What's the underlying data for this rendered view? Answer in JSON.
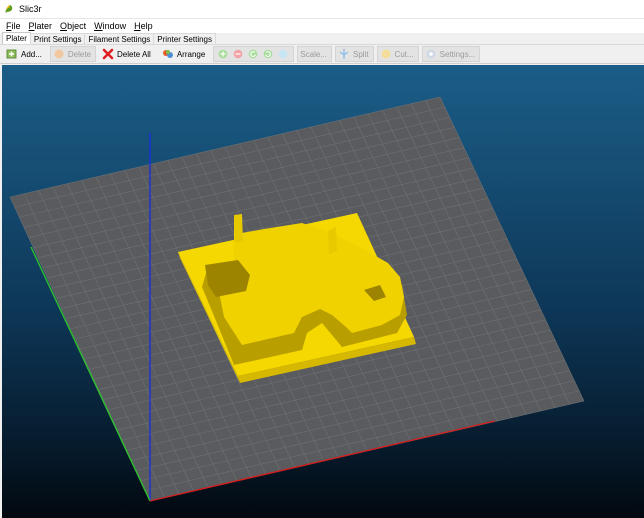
{
  "window": {
    "title": "Slic3r"
  },
  "menu": {
    "items": [
      {
        "label": "File",
        "accel": "F",
        "rest": "ile"
      },
      {
        "label": "Plater",
        "accel": "P",
        "rest": "later"
      },
      {
        "label": "Object",
        "accel": "O",
        "rest": "bject"
      },
      {
        "label": "Window",
        "accel": "W",
        "rest": "indow"
      },
      {
        "label": "Help",
        "accel": "H",
        "rest": "elp"
      }
    ]
  },
  "tabs": [
    {
      "label": "Plater",
      "active": true
    },
    {
      "label": "Print Settings",
      "active": false
    },
    {
      "label": "Filament Settings",
      "active": false
    },
    {
      "label": "Printer Settings",
      "active": false
    }
  ],
  "toolbar": {
    "add": "Add...",
    "delete": "Delete",
    "delete_all": "Delete All",
    "arrange": "Arrange",
    "scale": "Scale...",
    "split": "Split",
    "cut": "Cut...",
    "settings": "Settings..."
  },
  "colors": {
    "object_yellow": "#f5d800",
    "axis_x": "#d21f1f",
    "axis_y": "#2fbf2f",
    "axis_z": "#1d2fd8",
    "bed": "#595b5e"
  }
}
